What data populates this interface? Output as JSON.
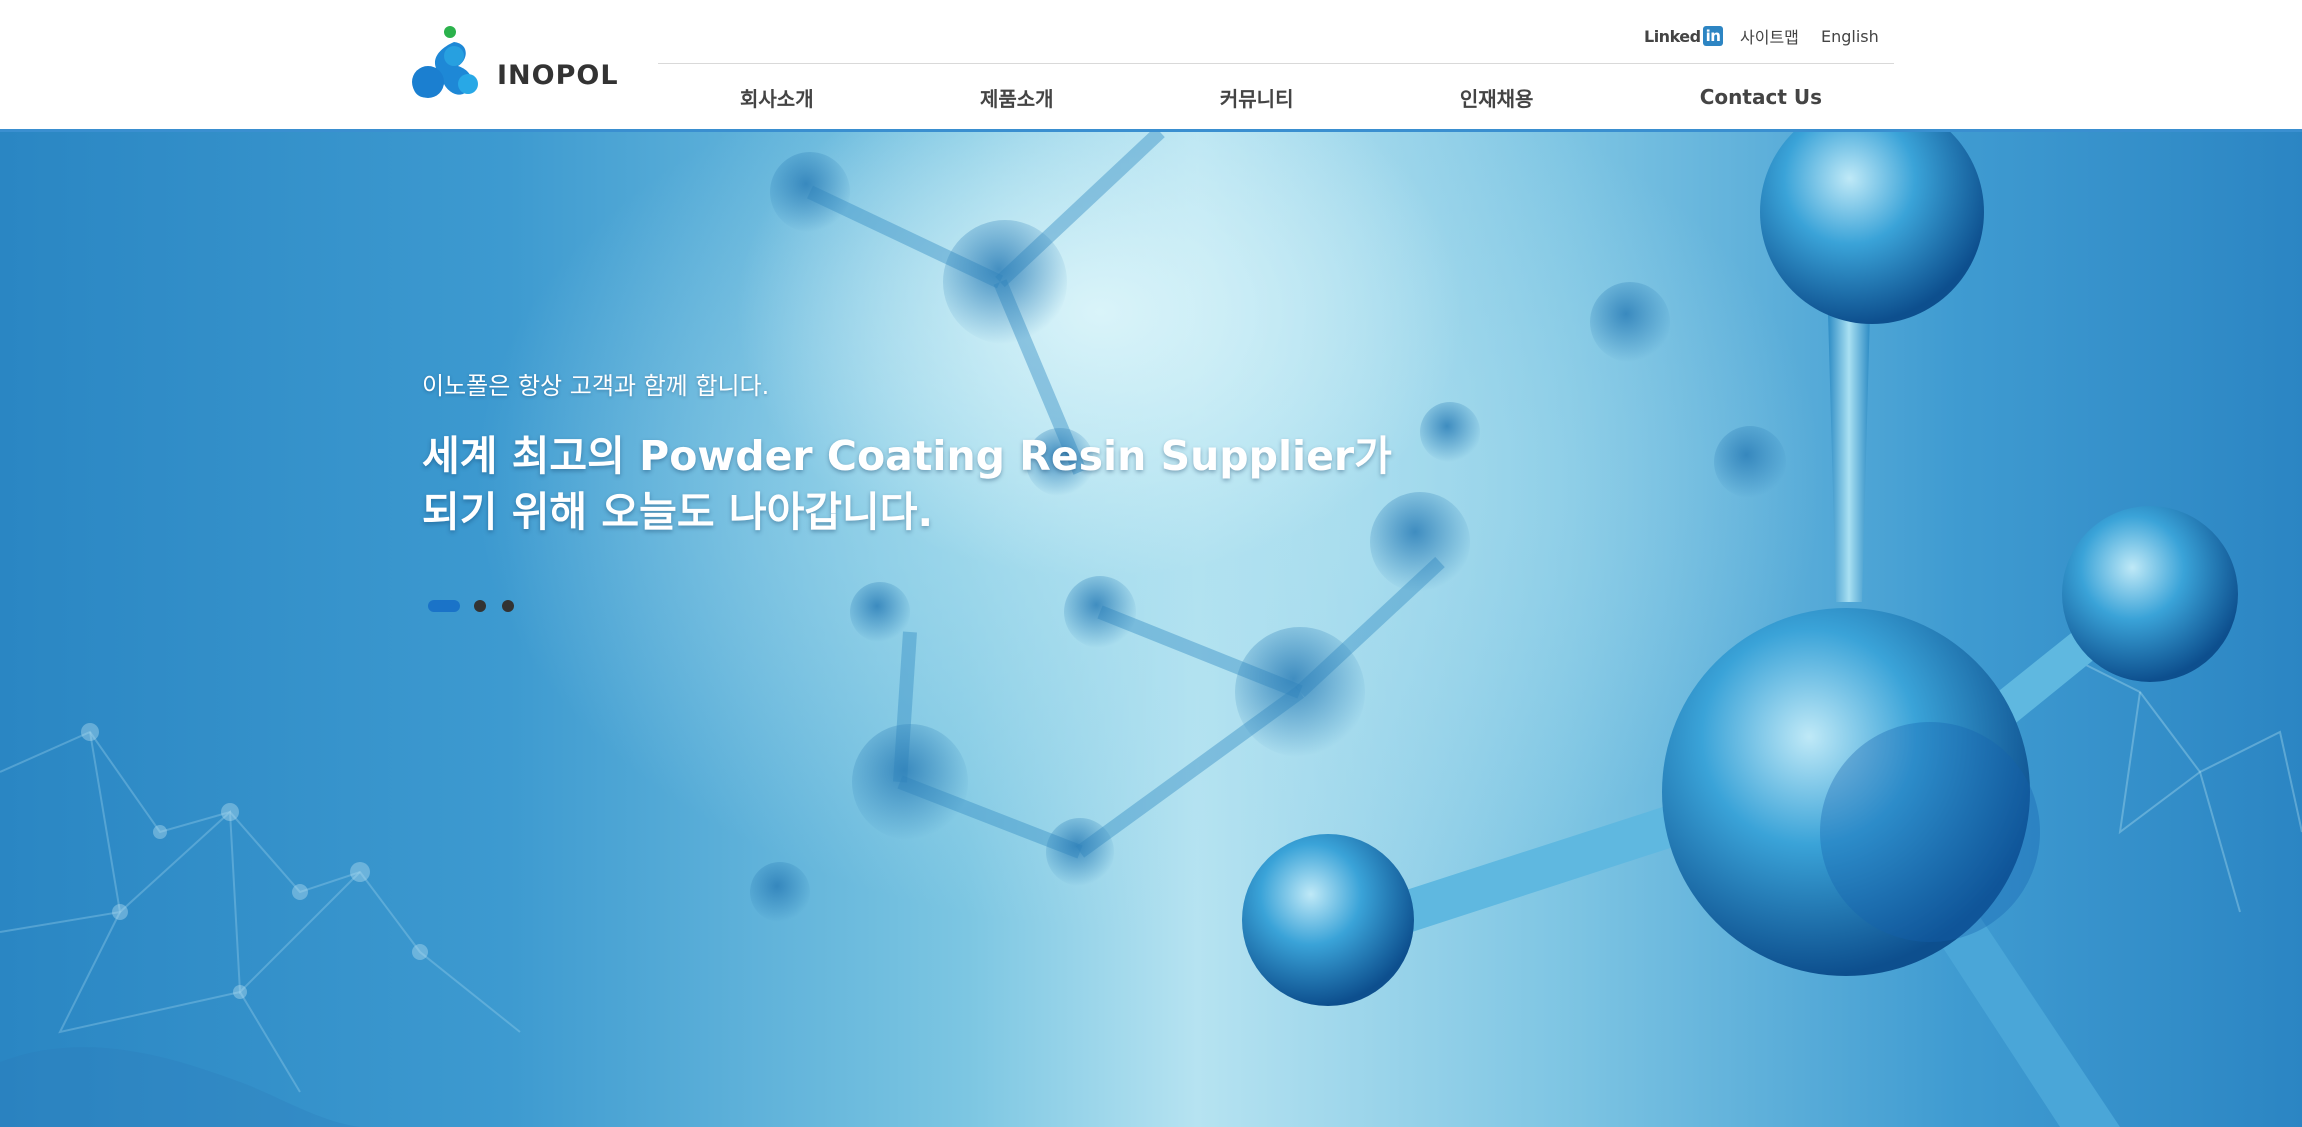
{
  "brand": {
    "name": "INOPOL",
    "logo_icon": "molecule-logo-icon"
  },
  "utility": {
    "linkedin_label": "Linked",
    "linkedin_in": "in",
    "sitemap": "사이트맵",
    "english": "English"
  },
  "nav": {
    "items": [
      "회사소개",
      "제품소개",
      "커뮤니티",
      "인재채용",
      "Contact Us"
    ]
  },
  "hero": {
    "subtitle": "이노폴은 항상 고객과 함께 합니다.",
    "title_line1": "세계 최고의 Powder Coating Resin Supplier가",
    "title_line2": "되기 위해 오늘도 나아갑니다.",
    "slides_total": 3,
    "active_slide": 1
  },
  "colors": {
    "accent": "#1a73c8",
    "header_border": "#3a8fd0",
    "logo_green": "#2bb24c",
    "logo_blue": "#1e88d6"
  }
}
